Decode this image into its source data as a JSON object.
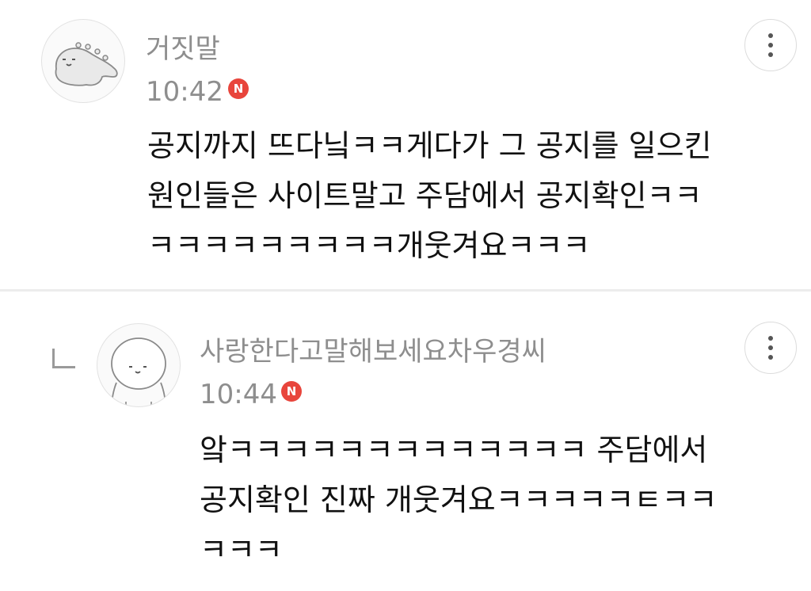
{
  "comments": [
    {
      "author": "거짓말",
      "time": "10:42",
      "badge": "N",
      "lines": [
        "공지까지 뜨다닠ㅋㅋ게다가 그 공지를 일으킨",
        "원인들은 사이트말고 주담에서 공지확인ㅋㅋ",
        "ㅋㅋㅋㅋㅋㅋㅋㅋㅋ개웃겨요ㅋㅋㅋ"
      ]
    },
    {
      "author": "사랑한다고말해보세요차우경씨",
      "time": "10:44",
      "badge": "N",
      "lines": [
        "앜ㅋㅋㅋㅋㅋㅋㅋㅋㅋㅋㅋㅋㅋ 주담에서",
        "공지확인 진짜 개웃겨요ㅋㅋㅋㅋㅋㅌㅋㅋ",
        "ㅋㅋㅋ"
      ]
    }
  ]
}
